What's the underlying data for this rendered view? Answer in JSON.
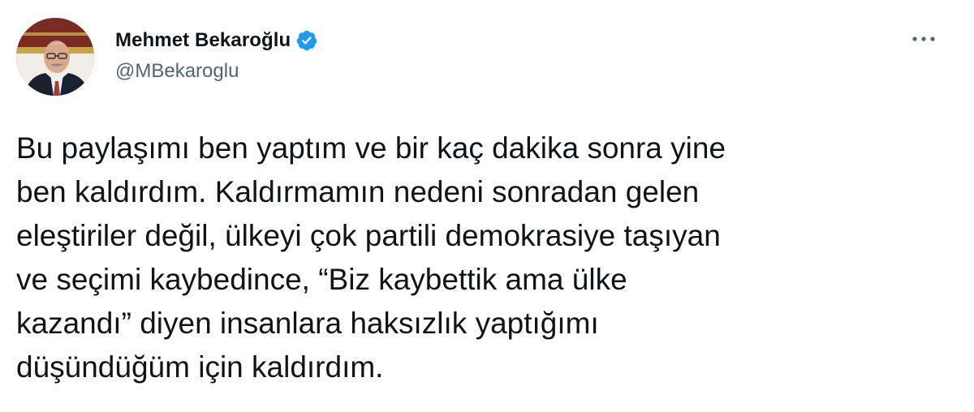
{
  "author": {
    "display_name": "Mehmet Bekaroğlu",
    "handle": "@MBekaroglu",
    "verified_icon": "verified-badge-icon",
    "avatar_icon": "avatar-photo"
  },
  "header": {
    "more_icon": "more-options-icon"
  },
  "tweet": {
    "lines": [
      "Bu paylaşımı ben yaptım ve bir kaç dakika sonra yine",
      "ben kaldırdım. Kaldırmamın nedeni sonradan gelen",
      "eleştiriler değil, ülkeyi çok partili demokrasiye taşıyan",
      "ve seçimi kaybedince, “Biz kaybettik ama ülke",
      "kazandı” diyen insanlara haksızlık yaptığımı",
      "düşündüğüm için kaldırdım."
    ]
  },
  "colors": {
    "text": "#0f1419",
    "secondary": "#536471",
    "verified": "#1d9bf0"
  }
}
